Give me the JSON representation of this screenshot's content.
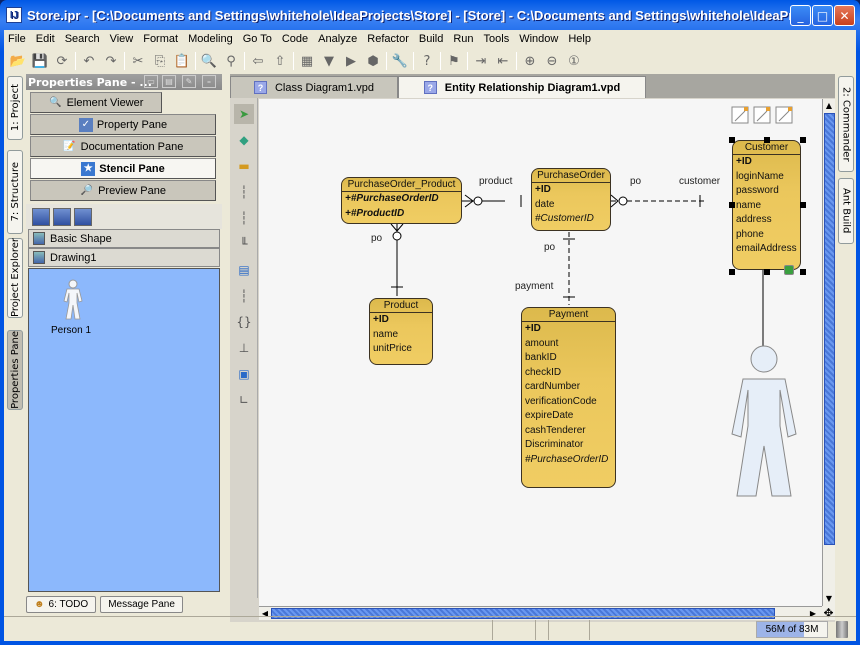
{
  "window": {
    "title": "Store.ipr - [C:\\Documents and Settings\\whitehole\\IdeaProjects\\Store] - [Store] - C:\\Documents and Settings\\whitehole\\IdeaProj...",
    "app_icon": "intellij-icon",
    "controls": {
      "minimize": "_",
      "maximize": "□",
      "close": "✕"
    }
  },
  "menu": [
    "File",
    "Edit",
    "Search",
    "View",
    "Format",
    "Modeling",
    "Go To",
    "Code",
    "Analyze",
    "Refactor",
    "Build",
    "Run",
    "Tools",
    "Window",
    "Help"
  ],
  "toolbar": [
    {
      "name": "open-icon",
      "glyph": "📂"
    },
    {
      "name": "save-icon",
      "glyph": "💾"
    },
    {
      "name": "sync-icon",
      "glyph": "⟳"
    },
    {
      "sep": true
    },
    {
      "name": "undo-icon",
      "glyph": "↶"
    },
    {
      "name": "redo-icon",
      "glyph": "↷"
    },
    {
      "sep": true
    },
    {
      "name": "cut-icon",
      "glyph": "✂"
    },
    {
      "name": "copy-icon",
      "glyph": "⎘"
    },
    {
      "name": "paste-icon",
      "glyph": "📋"
    },
    {
      "sep": true
    },
    {
      "name": "find-icon",
      "glyph": "🔍"
    },
    {
      "name": "replace-icon",
      "glyph": "⚲"
    },
    {
      "sep": true
    },
    {
      "name": "back-icon",
      "glyph": "⇦"
    },
    {
      "name": "forward-icon",
      "glyph": "⇧"
    },
    {
      "sep": true
    },
    {
      "name": "binary-icon",
      "glyph": "▦"
    },
    {
      "name": "run-config-dropdown",
      "glyph": "▼"
    },
    {
      "name": "run-icon",
      "glyph": "▶"
    },
    {
      "name": "debug-icon",
      "glyph": "⬢"
    },
    {
      "sep": true
    },
    {
      "name": "settings-icon",
      "glyph": "🔧"
    },
    {
      "sep": true
    },
    {
      "name": "help-icon",
      "glyph": "?"
    },
    {
      "sep": true
    },
    {
      "name": "diagram-icon",
      "glyph": "⚑"
    },
    {
      "sep": true
    },
    {
      "name": "import-icon",
      "glyph": "⇥"
    },
    {
      "name": "export-icon",
      "glyph": "⇤"
    },
    {
      "sep": true
    },
    {
      "name": "zoom-in-icon",
      "glyph": "⊕"
    },
    {
      "name": "zoom-out-icon",
      "glyph": "⊖"
    },
    {
      "name": "zoom-actual-icon",
      "glyph": "①"
    }
  ],
  "left_tabs": [
    "1: Project",
    "7: Structure",
    "Project Explorer",
    "Properties Pane"
  ],
  "right_tabs": [
    "2: Commander",
    "Ant Build"
  ],
  "properties_pane": {
    "title": "Properties Pane - ...",
    "buttons": [
      {
        "label": "Element Viewer",
        "icon": "magnifier-icon",
        "active": false
      },
      {
        "label": "Property Pane",
        "icon": "property-icon",
        "active": false
      },
      {
        "label": "Documentation Pane",
        "icon": "document-icon",
        "active": false
      },
      {
        "label": "Stencil Pane",
        "icon": "star-icon",
        "active": true
      },
      {
        "label": "Preview Pane",
        "icon": "preview-icon",
        "active": false
      }
    ],
    "stencils": [
      "Basic Shape",
      "Drawing1"
    ],
    "shape": {
      "label": "Person 1"
    }
  },
  "editor": {
    "tabs": [
      {
        "label": "Class Diagram1.vpd",
        "active": false
      },
      {
        "label": "Entity Relationship Diagram1.vpd",
        "active": true
      }
    ],
    "palette": [
      "select-icon",
      "eraser-icon",
      "entity-icon",
      "one-one-relationship-icon",
      "one-many-relationship-icon",
      "many-many-relationship-icon",
      "view-icon",
      "note-connector-icon",
      "stored-procedure-icon",
      "sequence-icon",
      "table-icon",
      "anchor-icon"
    ]
  },
  "diagram": {
    "entities": {
      "pop": {
        "name": "PurchaseOrder_Product",
        "attrs": [
          {
            "t": "+#PurchaseOrderID",
            "s": "bi"
          },
          {
            "t": "+#ProductID",
            "s": "bi"
          }
        ]
      },
      "po": {
        "name": "PurchaseOrder",
        "attrs": [
          {
            "t": "+ID",
            "s": "b"
          },
          {
            "t": "date",
            "s": ""
          },
          {
            "t": "#CustomerID",
            "s": "i"
          }
        ]
      },
      "customer": {
        "name": "Customer",
        "attrs": [
          {
            "t": "+ID",
            "s": "b"
          },
          {
            "t": "loginName",
            "s": ""
          },
          {
            "t": "password",
            "s": ""
          },
          {
            "t": "name",
            "s": ""
          },
          {
            "t": "address",
            "s": ""
          },
          {
            "t": "phone",
            "s": ""
          },
          {
            "t": "emailAddress",
            "s": ""
          }
        ]
      },
      "product": {
        "name": "Product",
        "attrs": [
          {
            "t": "+ID",
            "s": "b"
          },
          {
            "t": "name",
            "s": ""
          },
          {
            "t": "unitPrice",
            "s": ""
          }
        ]
      },
      "payment": {
        "name": "Payment",
        "attrs": [
          {
            "t": "+ID",
            "s": "b"
          },
          {
            "t": "amount",
            "s": ""
          },
          {
            "t": "bankID",
            "s": ""
          },
          {
            "t": "checkID",
            "s": ""
          },
          {
            "t": "cardNumber",
            "s": ""
          },
          {
            "t": "verificationCode",
            "s": ""
          },
          {
            "t": "expireDate",
            "s": ""
          },
          {
            "t": "cashTenderer",
            "s": ""
          },
          {
            "t": "Discriminator",
            "s": ""
          },
          {
            "t": "#PurchaseOrderID",
            "s": "i"
          }
        ]
      }
    },
    "labels": {
      "product": "product",
      "po1": "po",
      "po2": "po",
      "customer": "customer",
      "po3": "po",
      "payment": "payment"
    }
  },
  "bottom_tabs": [
    "6: TODO",
    "Message Pane"
  ],
  "status": {
    "memory": "56M of 83M",
    "memory_used_fraction": 0.67
  }
}
